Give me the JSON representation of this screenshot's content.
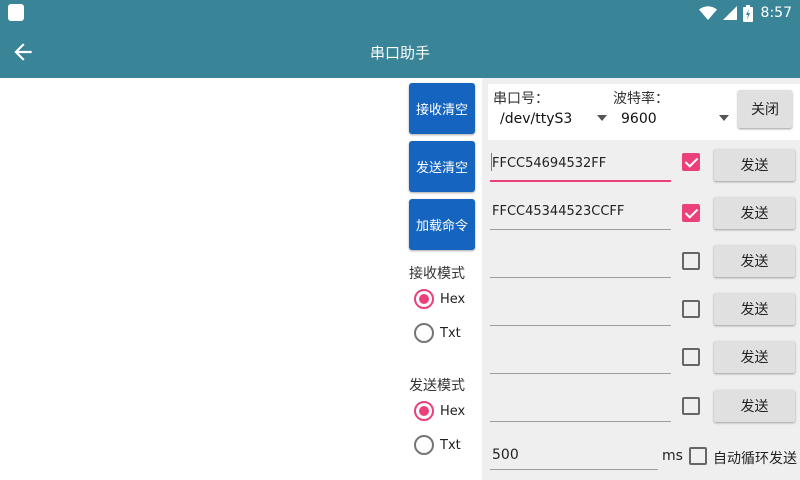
{
  "status_bar": {
    "time": "8:57",
    "icons": [
      "app-notification-icon",
      "wifi-icon",
      "cell-signal-icon",
      "battery-icon"
    ]
  },
  "toolbar": {
    "title": "串口助手",
    "back_icon": "arrow-left-icon"
  },
  "buttons": {
    "clear_receive": "接收清空",
    "clear_send": "发送清空",
    "load_commands": "加载命令"
  },
  "receive_mode": {
    "label": "接收模式",
    "options": [
      {
        "label": "Hex",
        "selected": true
      },
      {
        "label": "Txt",
        "selected": false
      }
    ]
  },
  "send_mode": {
    "label": "发送模式",
    "options": [
      {
        "label": "Hex",
        "selected": true
      },
      {
        "label": "Txt",
        "selected": false
      }
    ]
  },
  "serial_config": {
    "port_label": "串口号：",
    "port_value": "/dev/ttyS3",
    "baud_label": "波特率：",
    "baud_value": "9600",
    "close_label": "关闭"
  },
  "commands": [
    {
      "value": "FFCC54694532FF",
      "checked": true,
      "focused": true,
      "send_label": "发送"
    },
    {
      "value": "FFCC45344523CCFF",
      "checked": true,
      "focused": false,
      "send_label": "发送"
    },
    {
      "value": "",
      "checked": false,
      "focused": false,
      "send_label": "发送"
    },
    {
      "value": "",
      "checked": false,
      "focused": false,
      "send_label": "发送"
    },
    {
      "value": "",
      "checked": false,
      "focused": false,
      "send_label": "发送"
    },
    {
      "value": "",
      "checked": false,
      "focused": false,
      "send_label": "发送"
    }
  ],
  "auto_send": {
    "interval": "500",
    "unit": "ms",
    "label": "自动循环发送",
    "checked": false
  },
  "colors": {
    "primary": "#3a8497",
    "button_blue": "#1565c0",
    "accent": "#ec407a"
  }
}
